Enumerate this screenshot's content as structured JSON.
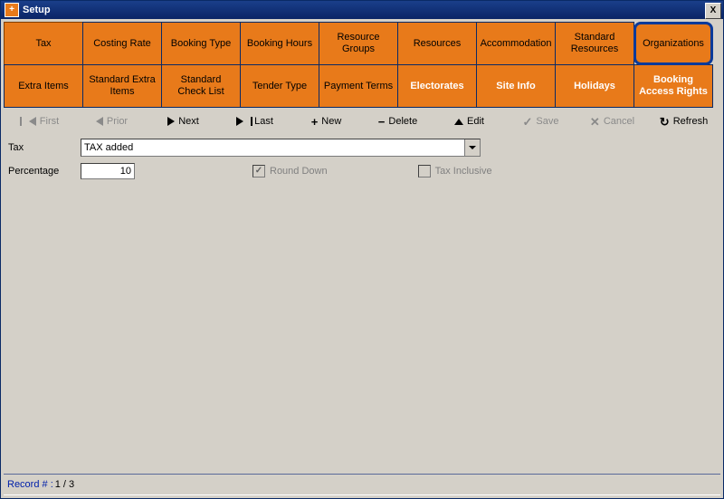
{
  "window": {
    "title": "Setup",
    "close": "X"
  },
  "tabs": {
    "r1": [
      "Tax",
      "Costing Rate",
      "Booking Type",
      "Booking Hours",
      "Resource Groups",
      "Resources",
      "Accommodation",
      "Standard Resources",
      "Organizations"
    ],
    "r2": [
      "Extra Items",
      "Standard Extra Items",
      "Standard Check List",
      "Tender Type",
      "Payment Terms",
      "Electorates",
      "Site Info",
      "Holidays",
      "Booking Access Rights"
    ]
  },
  "toolbar": {
    "first": "First",
    "prior": "Prior",
    "next": "Next",
    "last": "Last",
    "new": "New",
    "delete": "Delete",
    "edit": "Edit",
    "save": "Save",
    "cancel": "Cancel",
    "refresh": "Refresh",
    "plus": "+",
    "minus": "−",
    "check": "✓",
    "xmark": "✕",
    "refreshIcon": "↻"
  },
  "form": {
    "taxLabel": "Tax",
    "taxValue": "TAX added",
    "percentLabel": "Percentage",
    "percentValue": "10",
    "roundDownLabel": "Round Down",
    "taxInclusiveLabel": "Tax Inclusive"
  },
  "status": {
    "label": "Record # :",
    "value": " 1 / 3"
  }
}
